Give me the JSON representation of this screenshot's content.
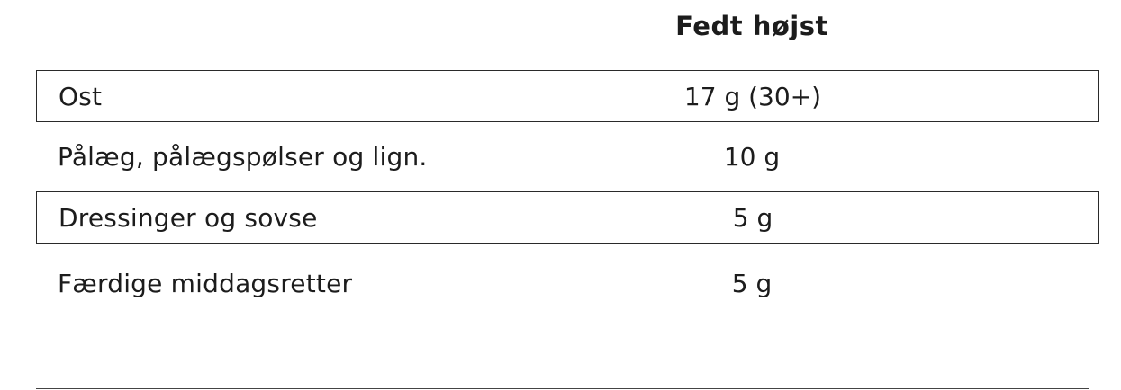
{
  "table": {
    "header": "Fedt højst",
    "rows": [
      {
        "label": "Ost",
        "value": "17 g (30+)",
        "boxed": true
      },
      {
        "label": "Pålæg, pålægspølser og lign.",
        "value": "10 g",
        "boxed": false
      },
      {
        "label": "Dressinger og sovse",
        "value": "5 g",
        "boxed": true
      },
      {
        "label": "Færdige middagsretter",
        "value": "5 g",
        "boxed": false
      }
    ]
  }
}
